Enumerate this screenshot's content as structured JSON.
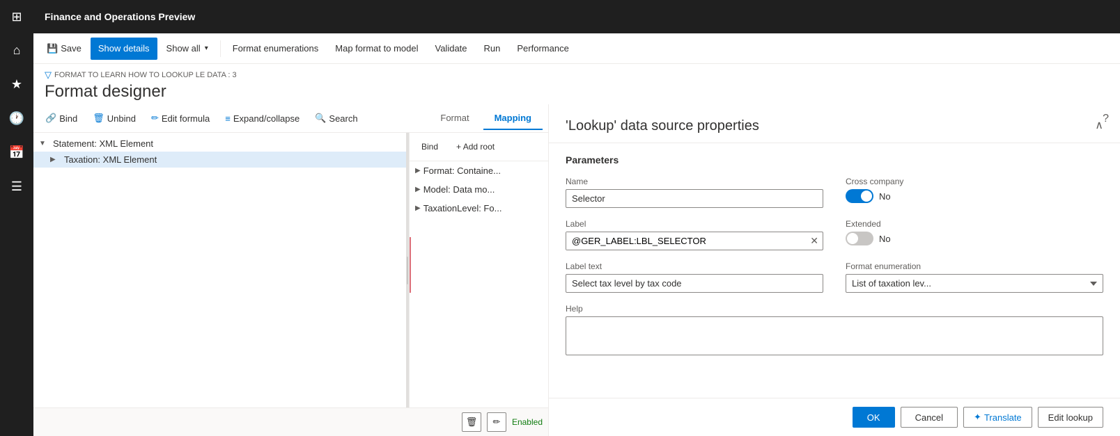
{
  "app": {
    "title": "Finance and Operations Preview"
  },
  "sidebar": {
    "icons": [
      "⊞",
      "⌂",
      "★",
      "🕐",
      "📅",
      "☰"
    ]
  },
  "toolbar": {
    "save_label": "Save",
    "show_details_label": "Show details",
    "show_all_label": "Show all",
    "format_enumerations_label": "Format enumerations",
    "map_format_label": "Map format to model",
    "validate_label": "Validate",
    "run_label": "Run",
    "performance_label": "Performance"
  },
  "page_header": {
    "breadcrumb": "FORMAT TO LEARN HOW TO LOOKUP LE DATA : 3",
    "title": "Format designer"
  },
  "sub_toolbar": {
    "bind_label": "Bind",
    "unbind_label": "Unbind",
    "edit_formula_label": "Edit formula",
    "expand_collapse_label": "Expand/collapse",
    "search_label": "Search"
  },
  "tabs": {
    "format_label": "Format",
    "mapping_label": "Mapping"
  },
  "tree": {
    "items": [
      {
        "label": "Statement: XML Element",
        "level": 0,
        "expanded": true,
        "selected": false
      },
      {
        "label": "Taxation: XML Element",
        "level": 1,
        "expanded": false,
        "selected": true
      }
    ]
  },
  "mapping": {
    "header_bind": "Bind",
    "header_add_root": "+ Add root",
    "items": [
      {
        "label": "Format: Containe..."
      },
      {
        "label": "Model: Data mo..."
      },
      {
        "label": "TaxationLevel: Fo..."
      }
    ]
  },
  "bottom_toolbar": {
    "delete_icon": "🗑",
    "edit_icon": "✏",
    "enabled_label": "Enabled"
  },
  "lookup_panel": {
    "title": "'Lookup' data source properties",
    "parameters_title": "Parameters",
    "collapse_icon": "∧",
    "name_label": "Name",
    "name_value": "Selector",
    "cross_company_label": "Cross company",
    "cross_company_value": "No",
    "label_label": "Label",
    "label_value": "@GER_LABEL:LBL_SELECTOR",
    "extended_label": "Extended",
    "extended_value": "No",
    "label_text_label": "Label text",
    "label_text_value": "Select tax level by tax code",
    "format_enumeration_label": "Format enumeration",
    "format_enumeration_value": "List of taxation lev...",
    "help_label": "Help",
    "help_value": "",
    "ok_label": "OK",
    "cancel_label": "Cancel",
    "translate_label": "Translate",
    "edit_lookup_label": "Edit lookup"
  },
  "help_icon": "?"
}
